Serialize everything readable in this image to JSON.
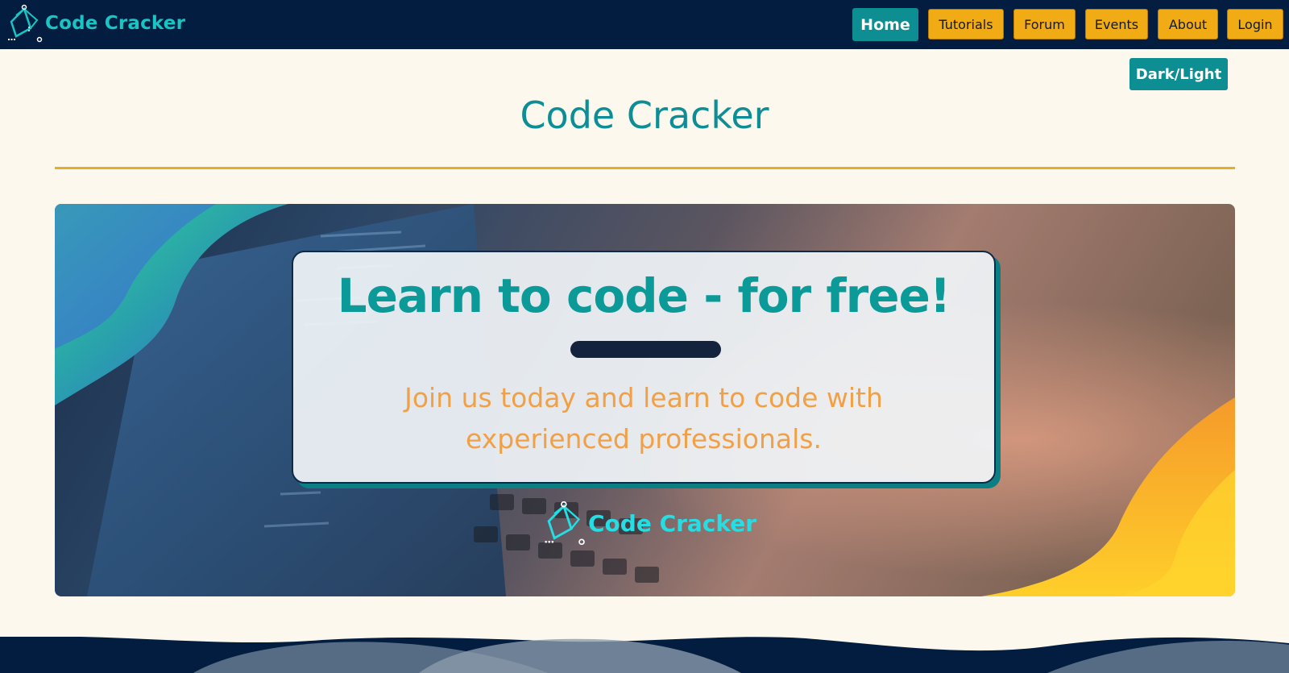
{
  "brand": {
    "name": "Code Cracker",
    "logo_icon": "code-cracker-logo-icon"
  },
  "nav": {
    "items": [
      {
        "label": "Home",
        "active": true
      },
      {
        "label": "Tutorials",
        "active": false
      },
      {
        "label": "Forum",
        "active": false
      },
      {
        "label": "Events",
        "active": false
      },
      {
        "label": "About",
        "active": false
      },
      {
        "label": "Login",
        "active": false
      }
    ]
  },
  "theme_toggle": {
    "label": "Dark/Light"
  },
  "page": {
    "title": "Code Cracker"
  },
  "hero": {
    "headline": "Learn to code - for free!",
    "subtext": "Join us today and learn to code with experienced professionals.",
    "logo_text": "Code Cracker"
  },
  "colors": {
    "navbar": "#021d3f",
    "accent_teal": "#0c8e93",
    "nav_button_yellow": "#f0ab15",
    "divider": "#e4ad2c",
    "background": "#fdf8ed",
    "subtext_orange": "#f2a046"
  }
}
